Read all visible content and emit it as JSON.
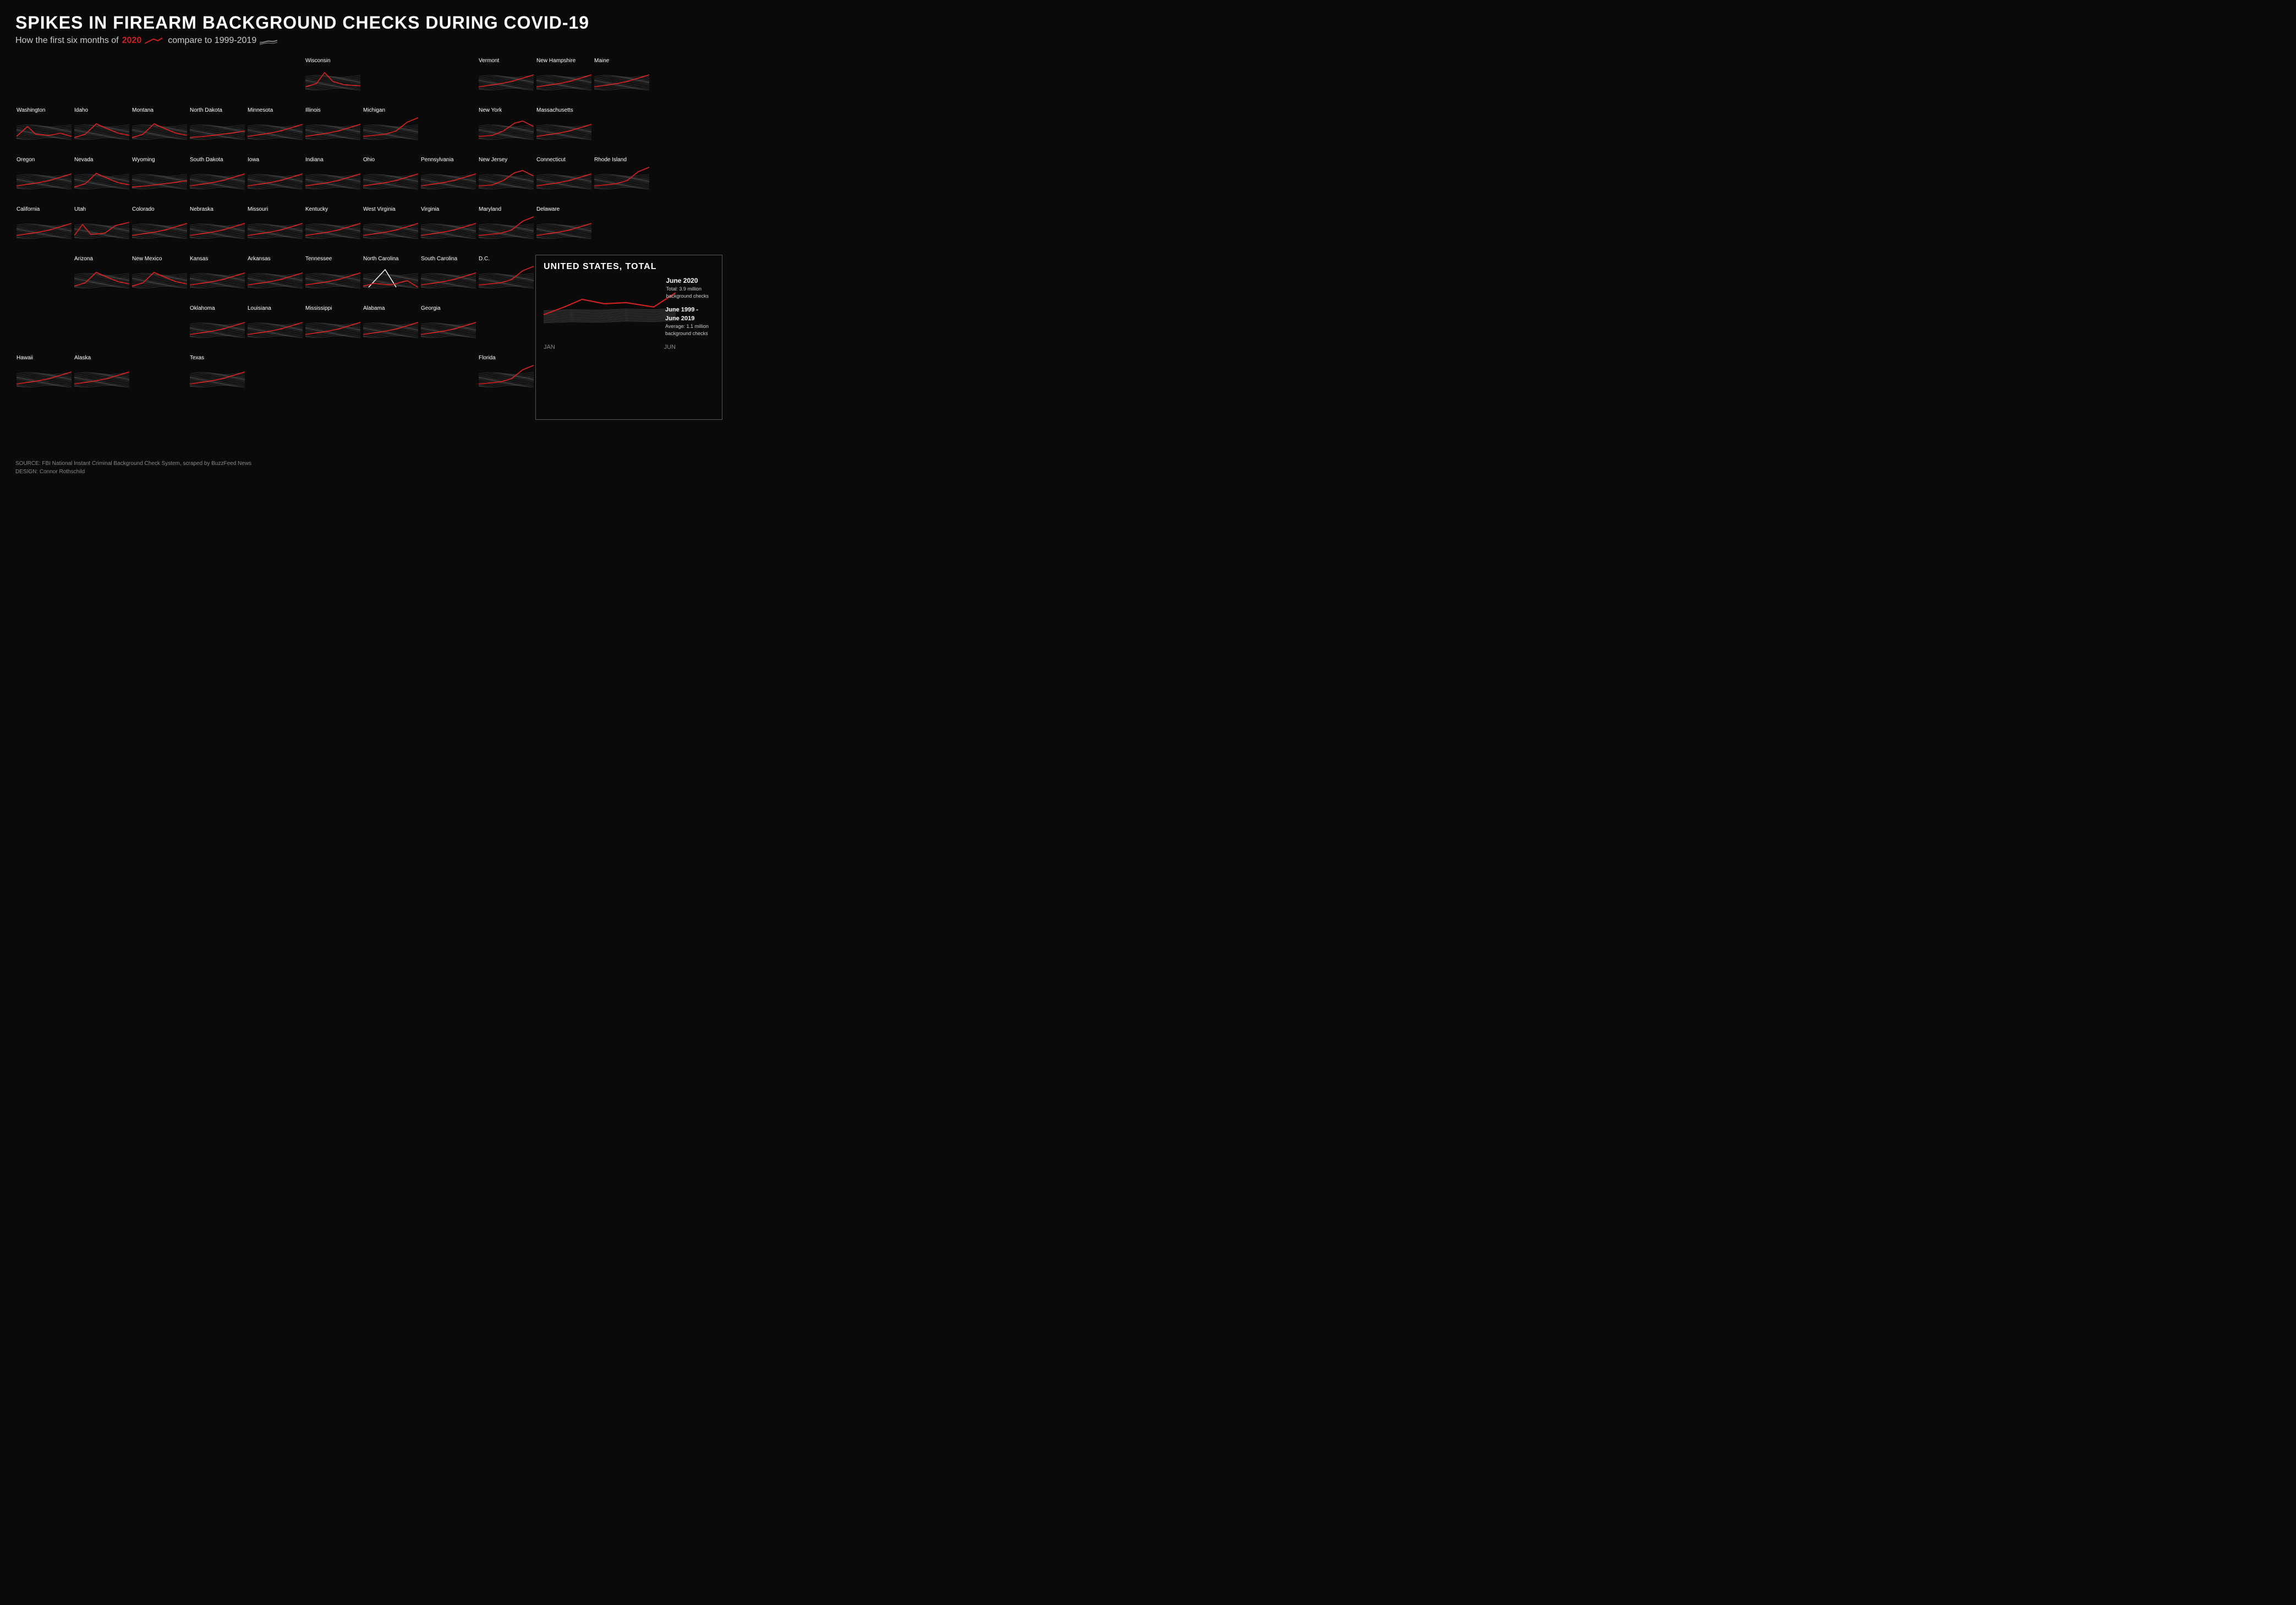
{
  "title": "SPIKES IN FIREARM BACKGROUND CHECKS DURING COVID-19",
  "subtitle_prefix": "How the first six months of",
  "subtitle_year": "2020",
  "subtitle_suffix": "compare to 1999-2019",
  "footer_source": "SOURCE: FBI National Instant Criminal Background Check System, scraped by BuzzFeed News",
  "footer_design": "DESIGN: Connor Rothschild",
  "us_total_title": "UNITED STATES, TOTAL",
  "us_june2020_label": "June 2020",
  "us_june2020_desc": "Total: 3.9 million\nbackground checks",
  "us_june1999_label": "June 1999 -\nJune 2019",
  "us_june1999_desc": "Average: 1.1 million\nbackground checks",
  "us_axis_jan": "JAN",
  "us_axis_jun": "JUN",
  "states": [
    {
      "name": "Wisconsin",
      "col": 6,
      "row": 1,
      "type": "peak_early"
    },
    {
      "name": "Vermont",
      "col": 9,
      "row": 1,
      "type": "moderate_up"
    },
    {
      "name": "New Hampshire",
      "col": 10,
      "row": 1,
      "type": "moderate_up"
    },
    {
      "name": "Maine",
      "col": 11,
      "row": 1,
      "type": "moderate_up"
    },
    {
      "name": "Washington",
      "col": 1,
      "row": 2,
      "type": "spike_late"
    },
    {
      "name": "Idaho",
      "col": 2,
      "row": 2,
      "type": "peak_mid"
    },
    {
      "name": "Montana",
      "col": 3,
      "row": 2,
      "type": "peak_mid"
    },
    {
      "name": "North Dakota",
      "col": 4,
      "row": 2,
      "type": "flat_slight"
    },
    {
      "name": "Minnesota",
      "col": 5,
      "row": 2,
      "type": "moderate_up"
    },
    {
      "name": "Illinois",
      "col": 6,
      "row": 2,
      "type": "moderate_up"
    },
    {
      "name": "Michigan",
      "col": 7,
      "row": 2,
      "type": "big_spike_late"
    },
    {
      "name": "New York",
      "col": 9,
      "row": 2,
      "type": "spike_mid_late"
    },
    {
      "name": "Massachusetts",
      "col": 10,
      "row": 2,
      "type": "moderate_up"
    },
    {
      "name": "Oregon",
      "col": 1,
      "row": 3,
      "type": "moderate_up"
    },
    {
      "name": "Nevada",
      "col": 2,
      "row": 3,
      "type": "peak_mid"
    },
    {
      "name": "Wyoming",
      "col": 3,
      "row": 3,
      "type": "flat_slight"
    },
    {
      "name": "South Dakota",
      "col": 4,
      "row": 3,
      "type": "moderate_up"
    },
    {
      "name": "Iowa",
      "col": 5,
      "row": 3,
      "type": "moderate_up"
    },
    {
      "name": "Indiana",
      "col": 6,
      "row": 3,
      "type": "moderate_up"
    },
    {
      "name": "Ohio",
      "col": 7,
      "row": 3,
      "type": "moderate_up"
    },
    {
      "name": "Pennsylvania",
      "col": 8,
      "row": 3,
      "type": "moderate_up"
    },
    {
      "name": "New Jersey",
      "col": 9,
      "row": 3,
      "type": "spike_mid_late"
    },
    {
      "name": "Connecticut",
      "col": 10,
      "row": 3,
      "type": "moderate_up"
    },
    {
      "name": "Rhode Island",
      "col": 11,
      "row": 3,
      "type": "big_spike_late"
    },
    {
      "name": "California",
      "col": 1,
      "row": 4,
      "type": "moderate_up"
    },
    {
      "name": "Utah",
      "col": 2,
      "row": 4,
      "type": "spike_early_late"
    },
    {
      "name": "Colorado",
      "col": 3,
      "row": 4,
      "type": "moderate_up"
    },
    {
      "name": "Nebraska",
      "col": 4,
      "row": 4,
      "type": "moderate_up"
    },
    {
      "name": "Missouri",
      "col": 5,
      "row": 4,
      "type": "moderate_up"
    },
    {
      "name": "Kentucky",
      "col": 6,
      "row": 4,
      "type": "moderate_up"
    },
    {
      "name": "West Virginia",
      "col": 7,
      "row": 4,
      "type": "moderate_up"
    },
    {
      "name": "Virginia",
      "col": 8,
      "row": 4,
      "type": "moderate_up"
    },
    {
      "name": "Maryland",
      "col": 9,
      "row": 4,
      "type": "big_spike_late"
    },
    {
      "name": "Delaware",
      "col": 10,
      "row": 4,
      "type": "moderate_up"
    },
    {
      "name": "Arizona",
      "col": 2,
      "row": 5,
      "type": "peak_mid"
    },
    {
      "name": "New Mexico",
      "col": 3,
      "row": 5,
      "type": "peak_mid"
    },
    {
      "name": "Kansas",
      "col": 4,
      "row": 5,
      "type": "moderate_up"
    },
    {
      "name": "Arkansas",
      "col": 5,
      "row": 5,
      "type": "moderate_up"
    },
    {
      "name": "Tennessee",
      "col": 6,
      "row": 5,
      "type": "moderate_up"
    },
    {
      "name": "North Carolina",
      "col": 7,
      "row": 5,
      "type": "spike_v_white"
    },
    {
      "name": "South Carolina",
      "col": 8,
      "row": 5,
      "type": "moderate_up"
    },
    {
      "name": "D.C.",
      "col": 9,
      "row": 5,
      "type": "big_spike_late"
    },
    {
      "name": "Oklahoma",
      "col": 4,
      "row": 6,
      "type": "moderate_up"
    },
    {
      "name": "Louisiana",
      "col": 5,
      "row": 6,
      "type": "moderate_up"
    },
    {
      "name": "Mississippi",
      "col": 6,
      "row": 6,
      "type": "moderate_up"
    },
    {
      "name": "Alabama",
      "col": 7,
      "row": 6,
      "type": "moderate_up"
    },
    {
      "name": "Georgia",
      "col": 8,
      "row": 6,
      "type": "moderate_up"
    },
    {
      "name": "Hawaii",
      "col": 1,
      "row": 7,
      "type": "moderate_up"
    },
    {
      "name": "Alaska",
      "col": 2,
      "row": 7,
      "type": "moderate_up"
    },
    {
      "name": "Texas",
      "col": 4,
      "row": 7,
      "type": "moderate_up"
    },
    {
      "name": "Florida",
      "col": 9,
      "row": 7,
      "type": "big_spike_late"
    }
  ]
}
